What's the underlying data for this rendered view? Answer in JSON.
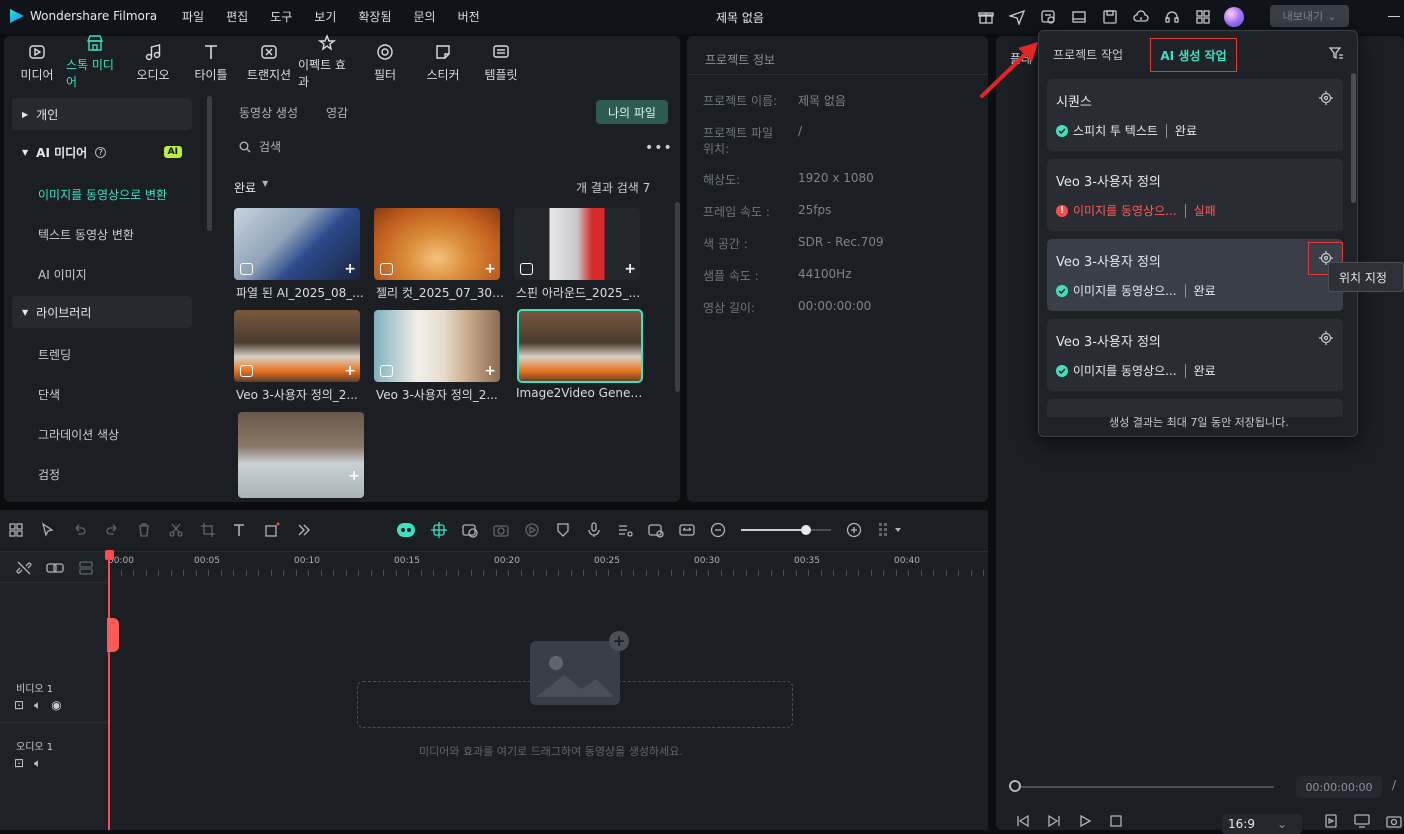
{
  "app": {
    "name": "Wondershare Filmora",
    "doc_title": "제목 없음",
    "export_label": "내보내기"
  },
  "menu": [
    "파일",
    "편집",
    "도구",
    "보기",
    "확장됨",
    "문의",
    "버전"
  ],
  "media_tabs": [
    {
      "label": "미디어",
      "icon": "media-icon"
    },
    {
      "label": "스톡 미디어",
      "icon": "stock-media-icon",
      "active": true
    },
    {
      "label": "오디오",
      "icon": "music-note-icon"
    },
    {
      "label": "타이틀",
      "icon": "title-icon"
    },
    {
      "label": "트랜지션",
      "icon": "transition-icon"
    },
    {
      "label": "이펙트 효과",
      "icon": "effects-icon"
    },
    {
      "label": "필터",
      "icon": "filter-icon"
    },
    {
      "label": "스티커",
      "icon": "sticker-icon"
    },
    {
      "label": "템플릿",
      "icon": "template-icon"
    }
  ],
  "sidebar": {
    "personal": "개인",
    "ai_media": "AI 미디어",
    "ai_badge": "AI",
    "items_ai": [
      "이미지를 동영상으로 변환",
      "텍스트 동영상 변환",
      "AI 이미지"
    ],
    "library": "라이브러리",
    "items_lib": [
      "트렌딩",
      "단색",
      "그라데이션 색상",
      "검정"
    ]
  },
  "content": {
    "subtabs": [
      "동영상 생성",
      "영감"
    ],
    "my_files": "나의 파일",
    "search_placeholder": "검색",
    "sort_label": "완료",
    "result_count": "개 결과 검색 7",
    "thumbs": [
      {
        "label": "파열 된 AI_2025_08_..."
      },
      {
        "label": "젤리 컷_2025_07_30 ..."
      },
      {
        "label": "스핀 아라운드_2025_..."
      },
      {
        "label": "Veo 3-사용자 정의_2..."
      },
      {
        "label": "Veo 3-사용자 정의_2..."
      },
      {
        "label": "Image2Video Generat..."
      },
      {
        "label": ""
      }
    ]
  },
  "project_info": {
    "title": "프로젝트 정보",
    "rows": [
      {
        "k": "프로젝트 이름:",
        "v": "제목 없음"
      },
      {
        "k": "프로젝트 파일",
        "k2": "위치:",
        "v": "/"
      },
      {
        "k": "해상도:",
        "v": "1920 x 1080"
      },
      {
        "k": "프레임 속도 :",
        "v": "25fps"
      },
      {
        "k": "색 공간 :",
        "v": "SDR - Rec.709"
      },
      {
        "k": "샘플 속도 :",
        "v": "44100Hz"
      },
      {
        "k": "영상 길이:",
        "v": "00:00:00:00"
      }
    ]
  },
  "player": {
    "tab": "플레",
    "time": "00:00:00:00",
    "slash": "/",
    "ratio": "16:9"
  },
  "timeline": {
    "ruler": [
      "00:00",
      "00:05",
      "00:10",
      "00:15",
      "00:20",
      "00:25",
      "00:30",
      "00:35",
      "00:40"
    ],
    "video_track": "비디오 1",
    "audio_track": "오디오 1",
    "drop_hint": "미디어와 효과를 여기로 드래그하여 동영상을 생성하세요.",
    "zoom_level": 0.72
  },
  "popup": {
    "tab_project": "프로젝트 작업",
    "tab_ai": "AI 생성 작업",
    "cards": [
      {
        "title": "시퀀스",
        "status_icon": "ok",
        "status": "스피치 투 텍스트",
        "result": "완료"
      },
      {
        "title": "Veo 3-사용자 정의",
        "status_icon": "fail",
        "status": "이미지를 동영상으...",
        "result": "실패"
      },
      {
        "title": "Veo 3-사용자 정의",
        "status_icon": "ok",
        "status": "이미지를 동영상으...",
        "result": "완료"
      },
      {
        "title": "Veo 3-사용자 정의",
        "status_icon": "ok",
        "status": "이미지를 동영상으...",
        "result": "완료"
      }
    ],
    "footer": "생성 결과는 최대 7일 동안 저장됩니다.",
    "tooltip": "위치 지정"
  },
  "colors": {
    "accent": "#3fe0c2",
    "error": "#ff4b4b",
    "panel": "#1b1e23",
    "highlight_box": "#e03a3a"
  }
}
